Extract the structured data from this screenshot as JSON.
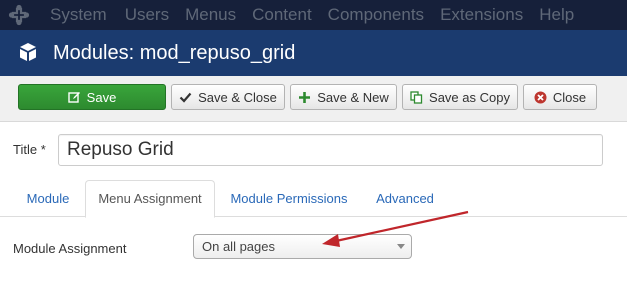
{
  "topbar": {
    "logo_icon": "joomla-logo-icon",
    "menu": [
      "System",
      "Users",
      "Menus",
      "Content",
      "Components",
      "Extensions",
      "Help"
    ]
  },
  "header": {
    "icon": "cube-icon",
    "title": "Modules: mod_repuso_grid"
  },
  "toolbar": {
    "save": "Save",
    "save_close": "Save & Close",
    "save_new": "Save & New",
    "save_copy": "Save as Copy",
    "close": "Close"
  },
  "form": {
    "title_label": "Title *",
    "title_value": "Repuso Grid"
  },
  "tabs": [
    "Module",
    "Menu Assignment",
    "Module Permissions",
    "Advanced"
  ],
  "active_tab": "Menu Assignment",
  "assignment": {
    "label": "Module Assignment",
    "selected": "On all pages"
  },
  "colors": {
    "topbar": "#16203a",
    "header": "#1b3b6f",
    "save_green": "#2d8a2f",
    "link_blue": "#2a69b8",
    "annotation_red": "#c0262b"
  }
}
